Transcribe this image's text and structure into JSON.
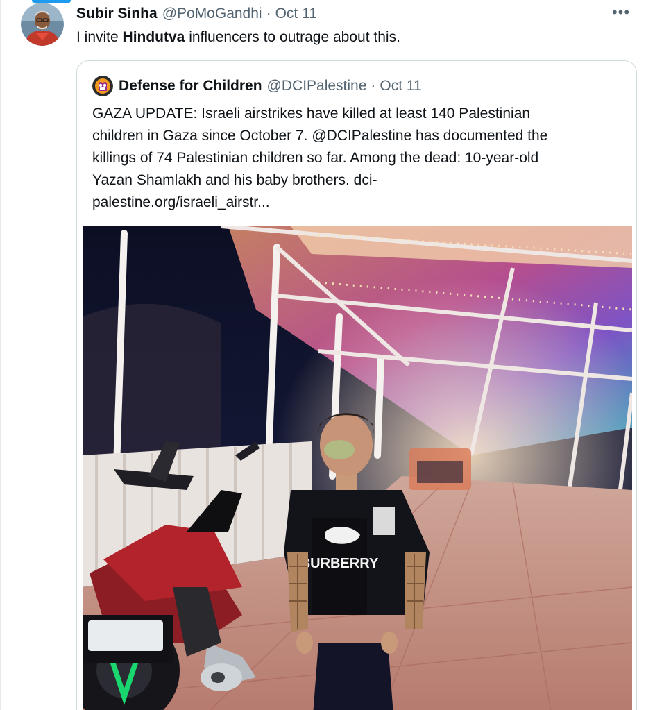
{
  "tweet": {
    "display_name": "Subir Sinha",
    "handle": "@PoMoGandhi",
    "separator": "·",
    "time": "Oct 11",
    "more_label": "•••",
    "text_before": "I invite ",
    "text_bold": "Hindutva",
    "text_after": " influencers to outrage about this."
  },
  "quote": {
    "display_name": "Defense for Children",
    "handle": "@DCIPalestine",
    "separator": "·",
    "time": "Oct 11",
    "text_lines": [
      "GAZA UPDATE: Israeli airstrikes have killed at least 140 Palestinian",
      "children in Gaza since October 7. @DCIPalestine has documented the",
      "killings of 74 Palestinian children so far. Among the dead: 10-year-old",
      "Yazan Shamlakh and his baby brothers. dci-",
      "palestine.org/israeli_airstr..."
    ],
    "media": {
      "shirt_text": "BURBERRY"
    }
  },
  "colors": {
    "accent": "#1d9bf0",
    "text_primary": "#0f1419",
    "text_secondary": "#536471",
    "border": "#cfd9de"
  },
  "icons": {
    "more": "more-horizontal-icon",
    "avatar": "profile-avatar",
    "quote_avatar": "dci-logo-avatar"
  }
}
